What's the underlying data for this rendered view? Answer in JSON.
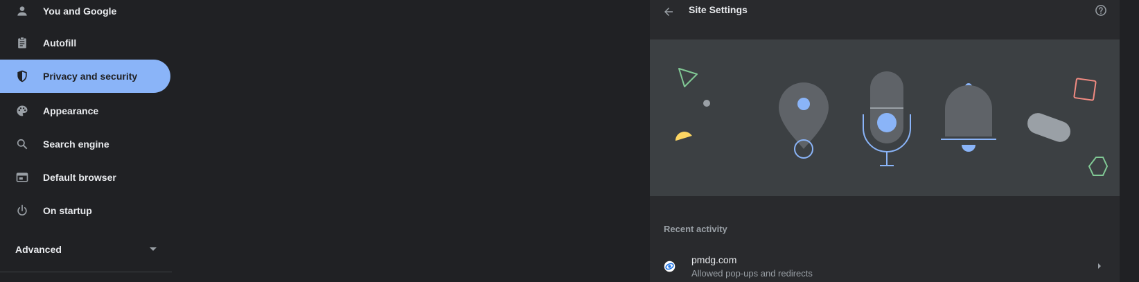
{
  "sidebar": {
    "items": [
      {
        "label": "You and Google",
        "icon": "person-icon"
      },
      {
        "label": "Autofill",
        "icon": "clipboard-icon"
      },
      {
        "label": "Privacy and security",
        "icon": "shield-icon",
        "active": true
      },
      {
        "label": "Appearance",
        "icon": "palette-icon"
      },
      {
        "label": "Search engine",
        "icon": "search-icon"
      },
      {
        "label": "Default browser",
        "icon": "browser-window-icon"
      },
      {
        "label": "On startup",
        "icon": "power-icon"
      }
    ],
    "advanced_label": "Advanced"
  },
  "panel": {
    "title": "Site Settings",
    "recent_activity_title": "Recent activity",
    "recent": [
      {
        "site": "pmdg.com",
        "description": "Allowed pop-ups and redirects"
      }
    ]
  },
  "colors": {
    "background": "#202124",
    "panel": "#292a2d",
    "banner": "#3c4043",
    "accent": "#8ab4f8",
    "text": "#e8eaed",
    "secondary_text": "#9aa0a6"
  }
}
